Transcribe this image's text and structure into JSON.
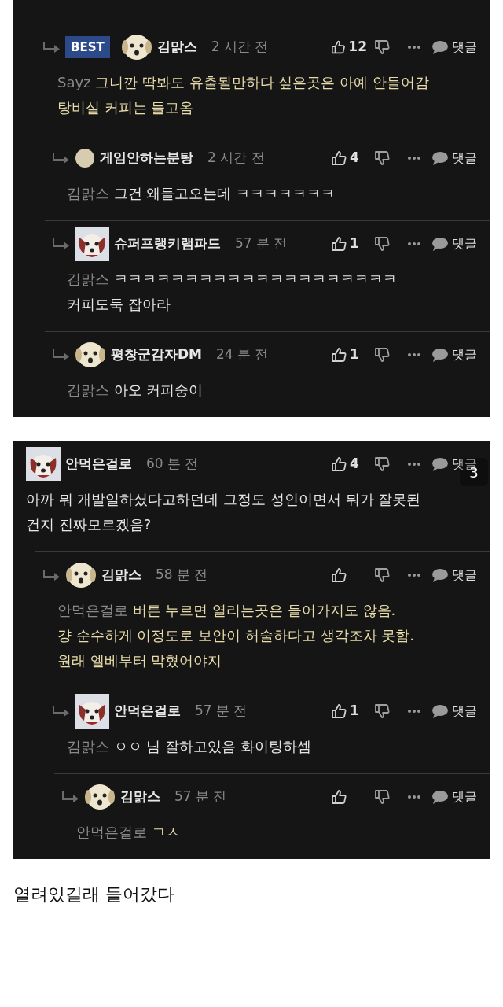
{
  "cards": [
    {
      "comments": [
        {
          "author": "김맑스",
          "best": "BEST",
          "avatar": {
            "kind": "dog"
          },
          "time": "2 시간 전",
          "likes": "12",
          "reply_label": "댓글",
          "mention": "Sayz",
          "highlighted": true,
          "text": "그니깐 딱봐도 유출될만하다 싶은곳은 아예 안들어감\n탕비실 커피는 들고옴",
          "children": [
            {
              "author": "게임안하는분탕",
              "avatar": {
                "kind": "plain"
              },
              "time": "2 시간 전",
              "likes": "4",
              "reply_label": "댓글",
              "mention": "김맑스",
              "highlighted": false,
              "text": "그건 왜들고오는데 ㅋㅋㅋㅋㅋㅋㅋ"
            },
            {
              "author": "슈퍼프랭키램파드",
              "avatar": {
                "kind": "dog-square"
              },
              "time": "57 분 전",
              "likes": "1",
              "reply_label": "댓글",
              "mention": "김맑스",
              "highlighted": false,
              "text": "ㅋㅋㅋㅋㅋㅋㅋㅋㅋㅋㅋㅋㅋㅋㅋㅋㅋㅋㅋㅋ\n커피도둑 잡아라"
            },
            {
              "author": "평창군감자DM",
              "avatar": {
                "kind": "dog"
              },
              "time": "24 분 전",
              "likes": "1",
              "reply_label": "댓글",
              "mention": "김맑스",
              "highlighted": false,
              "text": "아오 커피숭이"
            }
          ]
        }
      ]
    },
    {
      "comments": [
        {
          "author": "안먹은걸로",
          "avatar": {
            "kind": "dog-square"
          },
          "time": "60 분 전",
          "likes": "4",
          "reply_label": "댓글",
          "highlighted": false,
          "text": "아까 뭐 개발일하셨다고하던데 그정도 성인이면서 뭐가 잘못된\n건지 진짜모르겠음?",
          "children": [
            {
              "author": "김맑스",
              "avatar": {
                "kind": "dog"
              },
              "time": "58 분 전",
              "reply_label": "댓글",
              "mention": "안먹은걸로",
              "highlighted": true,
              "text": "버튼 누르면 열리는곳은 들어가지도 않음.\n걍 순수하게 이정도로 보안이 허술하다고 생각조차 못함.\n원래 엘베부터 막혔어야지",
              "children": [
                {
                  "author": "안먹은걸로",
                  "avatar": {
                    "kind": "dog-square"
                  },
                  "time": "57 분 전",
                  "likes": "1",
                  "reply_label": "댓글",
                  "mention": "김맑스",
                  "highlighted": false,
                  "text": "ㅇㅇ 님 잘하고있음 화이팅하셈",
                  "children": [
                    {
                      "author": "김맑스",
                      "avatar": {
                        "kind": "dog"
                      },
                      "time": "57 분 전",
                      "reply_label": "댓글",
                      "mention": "안먹은걸로",
                      "highlighted": true,
                      "text": "ㄱㅅ"
                    }
                  ]
                }
              ]
            }
          ]
        }
      ]
    }
  ],
  "page_indicator": "3",
  "caption": "열려있길래 들어갔다"
}
